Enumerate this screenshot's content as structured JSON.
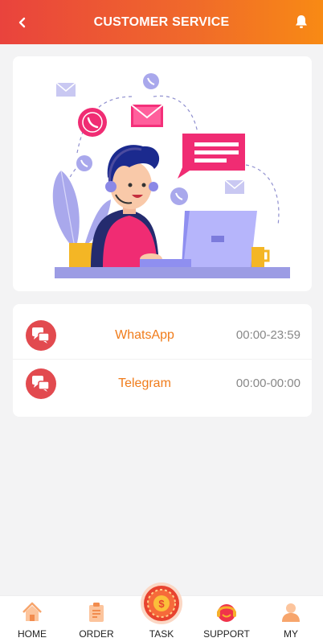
{
  "header": {
    "title": "CUSTOMER SERVICE",
    "back_icon": "chevron-left-icon",
    "bell_icon": "bell-icon"
  },
  "services": [
    {
      "name": "WhatsApp",
      "hours": "00:00-23:59",
      "icon": "chat-bubbles-icon"
    },
    {
      "name": "Telegram",
      "hours": "00:00-00:00",
      "icon": "chat-bubbles-icon"
    }
  ],
  "tabbar": {
    "items": [
      {
        "label": "HOME",
        "icon": "home-icon"
      },
      {
        "label": "ORDER",
        "icon": "clipboard-icon"
      },
      {
        "label": "TASK",
        "icon": "task-wheel-icon"
      },
      {
        "label": "SUPPORT",
        "icon": "headset-icon"
      },
      {
        "label": "MY",
        "icon": "user-icon"
      }
    ]
  },
  "colors": {
    "header_start": "#e9433d",
    "header_end": "#f88a14",
    "accent_text": "#f07c1b",
    "service_icon_bg": "#e24a4f"
  }
}
